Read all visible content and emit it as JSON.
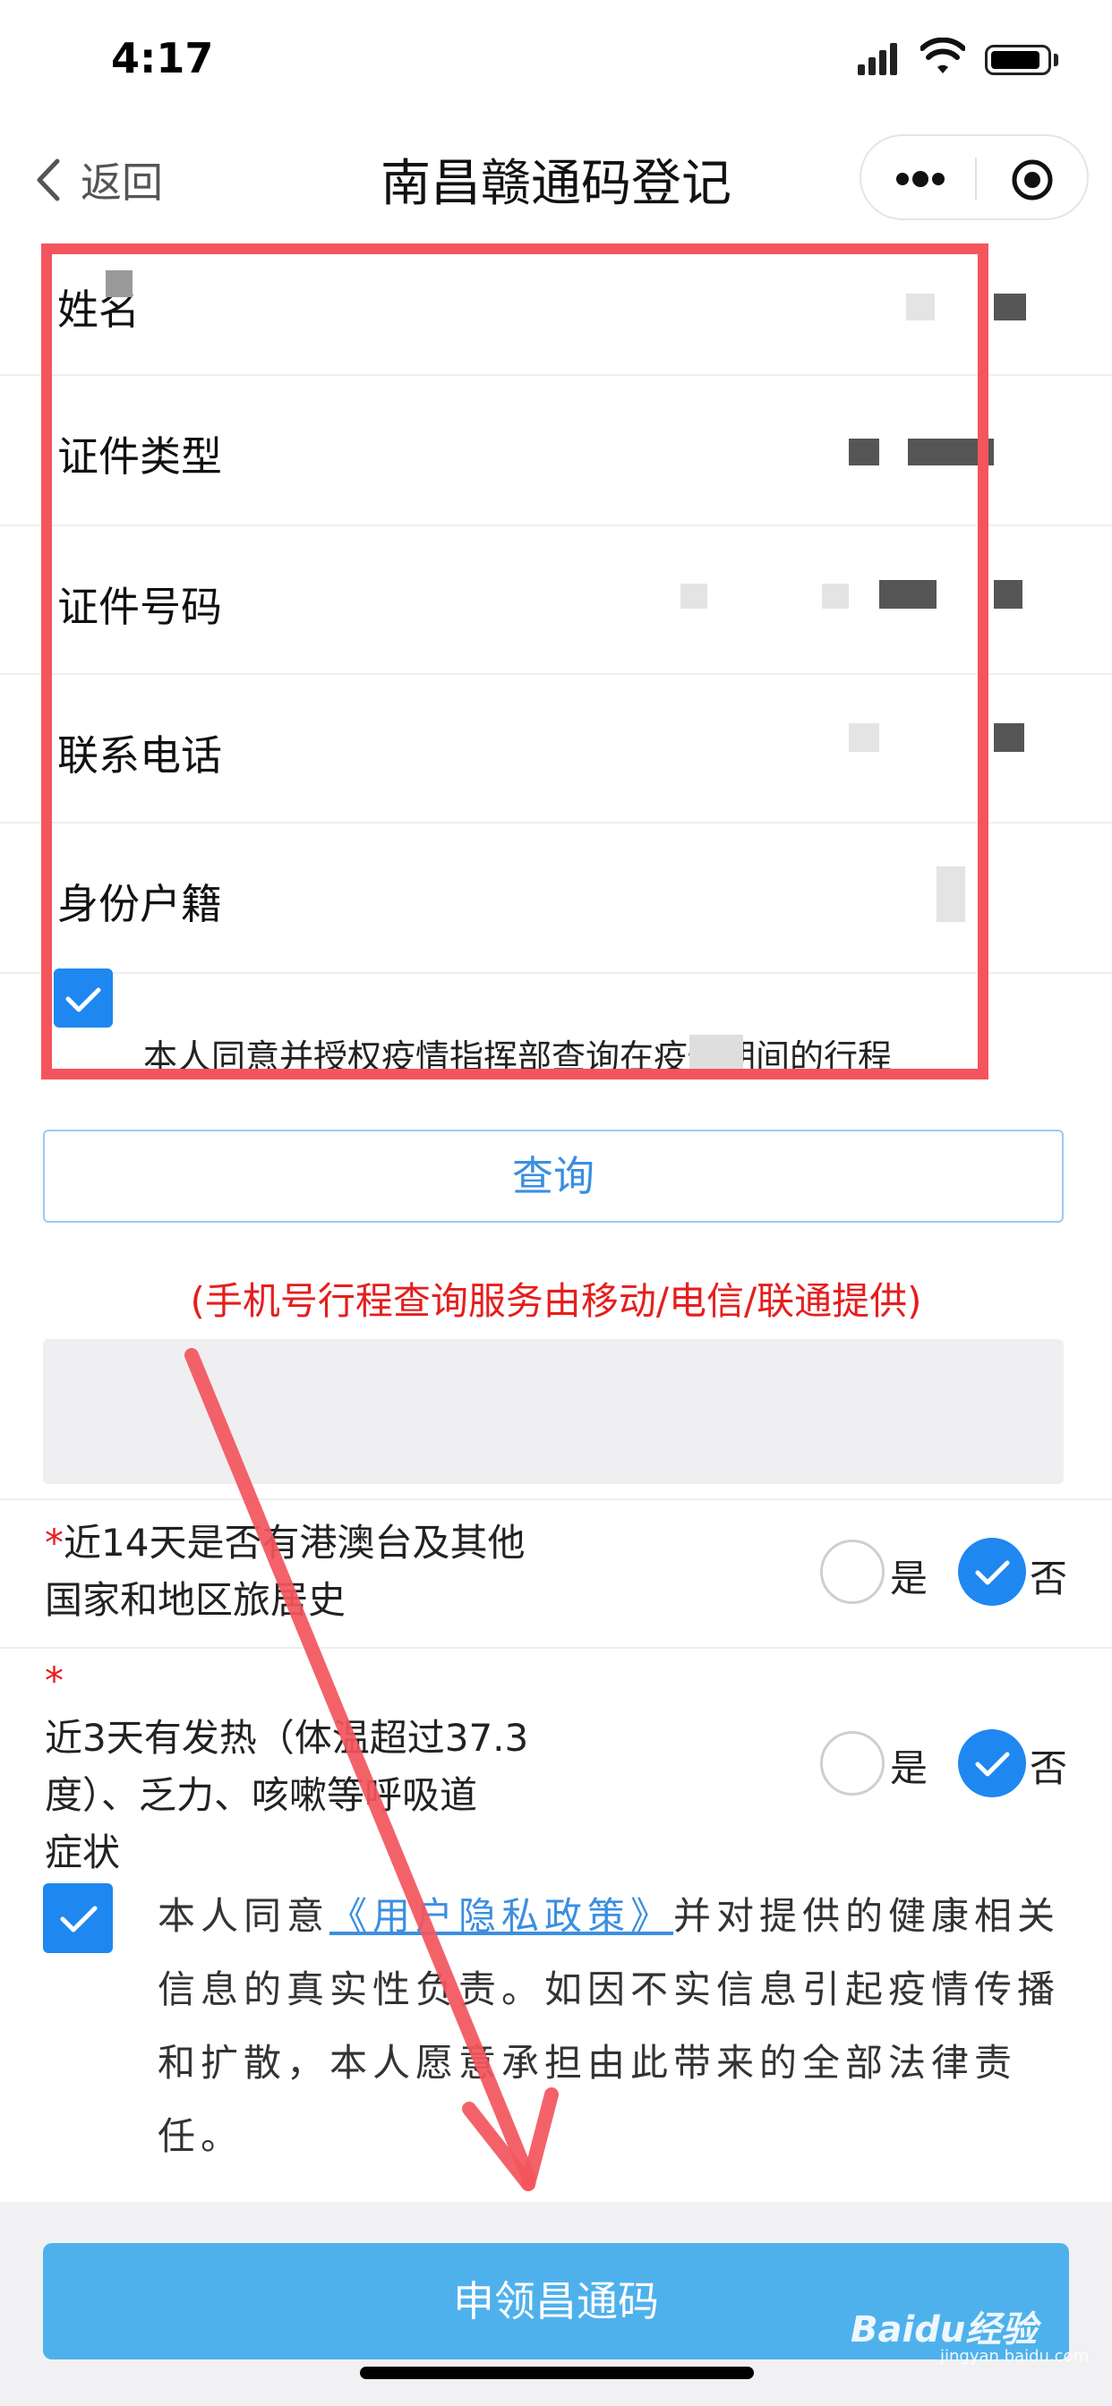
{
  "status_bar": {
    "time": "4:17"
  },
  "nav": {
    "back_label": "返回",
    "title": "南昌赣通码登记"
  },
  "form": {
    "rows": [
      {
        "label": "姓名"
      },
      {
        "label": "证件类型"
      },
      {
        "label": "证件号码"
      },
      {
        "label": "联系电话"
      },
      {
        "label": "身份户籍"
      }
    ],
    "auth_text": "本人同意并授权疫情指挥部查询在疫情期间的行程",
    "query_button": "查询",
    "provider_note": "(手机号行程查询服务由移动/电信/联通提供)"
  },
  "questions": [
    {
      "required_mark": "*",
      "text_line1": "近14天是否有港澳台及其他",
      "text_line2": "国家和地区旅居史",
      "yes_label": "是",
      "no_label": "否",
      "selected": "否"
    },
    {
      "required_mark": "*",
      "text_line1": "近3天有发热（体温超过37.3",
      "text_line2": "度）、乏力、咳嗽等呼吸道",
      "text_line3": "症状",
      "yes_label": "是",
      "no_label": "否",
      "selected": "否"
    }
  ],
  "agreement": {
    "prefix": "本人同意",
    "link": "《用户隐私政策》",
    "suffix": "并对提供的健康相关信息的真实性负责。如因不实信息引起疫情传播和扩散，本人愿意承担由此带来的全部法律责任。"
  },
  "apply_button": "申领昌通码",
  "watermark": {
    "brand": "Baidu经验",
    "sub": "jingyan.baidu.com"
  },
  "colors": {
    "accent": "#1e88f0",
    "annotation": "#f4555d",
    "warning": "#e61e1e",
    "button": "#4fb1ec"
  }
}
